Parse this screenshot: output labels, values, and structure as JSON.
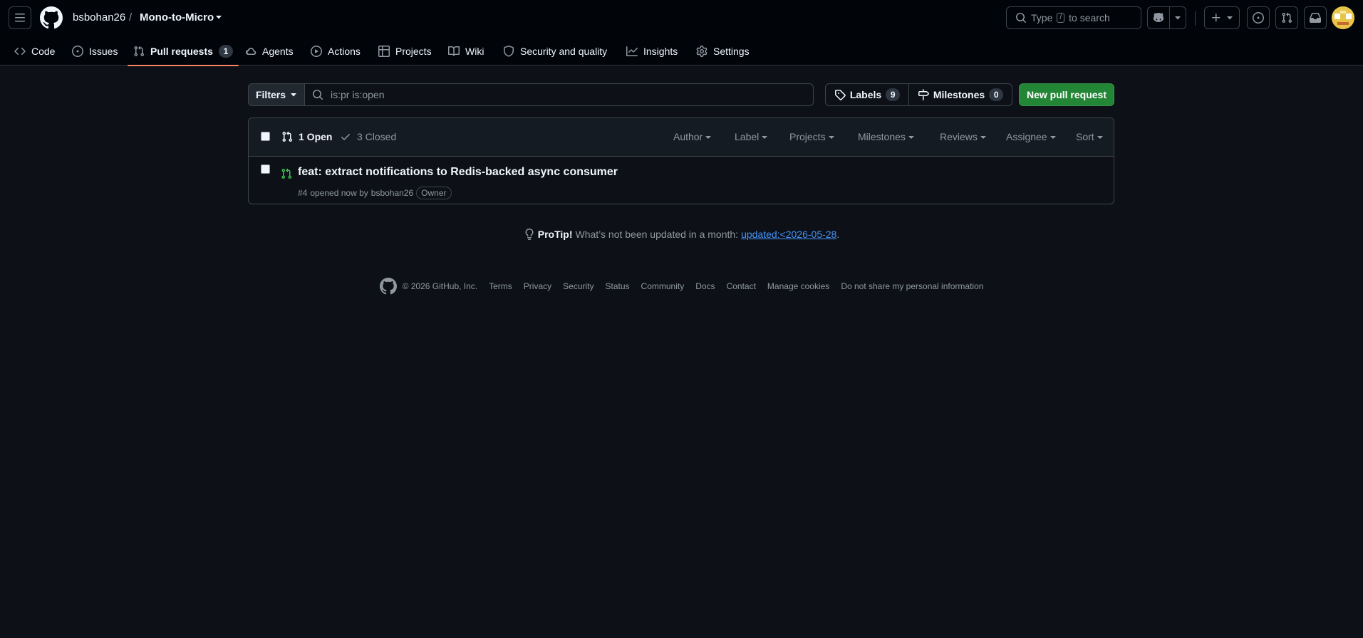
{
  "header": {
    "owner": "bsbohan26",
    "separator": "/",
    "repo": "Mono-to-Micro",
    "search_label_before": "Type",
    "search_kbd": "/",
    "search_label_after": "to search"
  },
  "nav": {
    "tabs": [
      {
        "label": "Code",
        "icon": "code-icon"
      },
      {
        "label": "Issues",
        "icon": "issue-opened-icon"
      },
      {
        "label": "Pull requests",
        "icon": "git-pull-request-icon",
        "count": "1",
        "selected": true
      },
      {
        "label": "Agents",
        "icon": "agent-cloud-icon"
      },
      {
        "label": "Actions",
        "icon": "play-icon"
      },
      {
        "label": "Projects",
        "icon": "table-icon"
      },
      {
        "label": "Wiki",
        "icon": "book-icon"
      },
      {
        "label": "Security and quality",
        "icon": "shield-icon"
      },
      {
        "label": "Insights",
        "icon": "graph-icon"
      },
      {
        "label": "Settings",
        "icon": "gear-icon"
      }
    ]
  },
  "toolbar": {
    "filters_label": "Filters",
    "search_value": "is:pr is:open",
    "labels_label": "Labels",
    "labels_count": "9",
    "milestones_label": "Milestones",
    "milestones_count": "0",
    "new_pr_label": "New pull request"
  },
  "list": {
    "open_label": "1 Open",
    "closed_label": "3 Closed",
    "filters": [
      "Author",
      "Label",
      "Projects",
      "Milestones",
      "Reviews",
      "Assignee",
      "Sort"
    ],
    "items": [
      {
        "title": "feat: extract notifications to Redis-backed async consumer",
        "number": "#4",
        "opened_text": "opened now by",
        "author": "bsbohan26",
        "badge": "Owner"
      }
    ]
  },
  "protip": {
    "prefix": "ProTip!",
    "text": "What’s not been updated in a month:",
    "link": "updated:<2026-05-28",
    "suffix": "."
  },
  "footer": {
    "copyright": "© 2026 GitHub, Inc.",
    "links": [
      "Terms",
      "Privacy",
      "Security",
      "Status",
      "Community",
      "Docs",
      "Contact",
      "Manage cookies",
      "Do not share my personal information"
    ]
  },
  "colors": {
    "background": "#0d1117",
    "header_bg": "#010409",
    "accent_underline": "#f78166",
    "open_green": "#3fb950",
    "primary_button": "#238636",
    "link_blue": "#4493f8"
  }
}
